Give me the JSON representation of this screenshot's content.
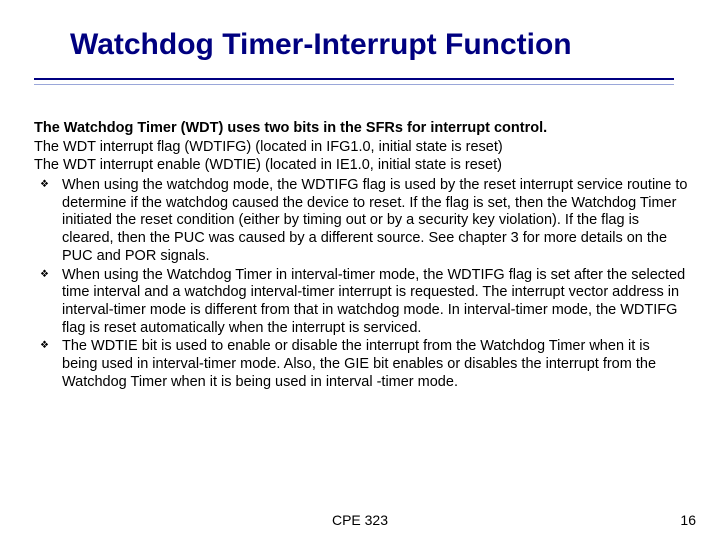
{
  "title": "Watchdog Timer-Interrupt Function",
  "lead": "The Watchdog Timer (WDT) uses two bits in the SFRs for interrupt control.",
  "lines": [
    "The WDT interrupt flag (WDTIFG) (located in IFG1.0, initial state is reset)",
    "The WDT interrupt enable (WDTIE) (located in IE1.0, initial state is reset)"
  ],
  "bullets": [
    "When using the watchdog mode, the WDTIFG flag is used by the reset interrupt service routine to determine if the watchdog caused the device to reset. If the flag is set, then the Watchdog Timer initiated the reset condition (either by timing out or by a security key violation). If the flag is cleared, then the PUC was caused by a different source. See chapter 3 for more details on the PUC and POR signals.",
    "When using the Watchdog Timer in interval-timer mode, the WDTIFG flag is set after the selected time interval and a watchdog interval-timer interrupt is requested. The interrupt vector address in interval-timer mode is different from that in watchdog mode. In interval-timer mode, the WDTIFG flag is reset automatically when the interrupt is serviced.",
    "The WDTIE bit is used to enable or disable the interrupt from the Watchdog Timer when it is being used in interval-timer mode. Also, the GIE bit enables or disables the interrupt from the Watchdog Timer when it is being used in interval -timer mode."
  ],
  "footer": {
    "center": "CPE 323",
    "page": "16"
  }
}
